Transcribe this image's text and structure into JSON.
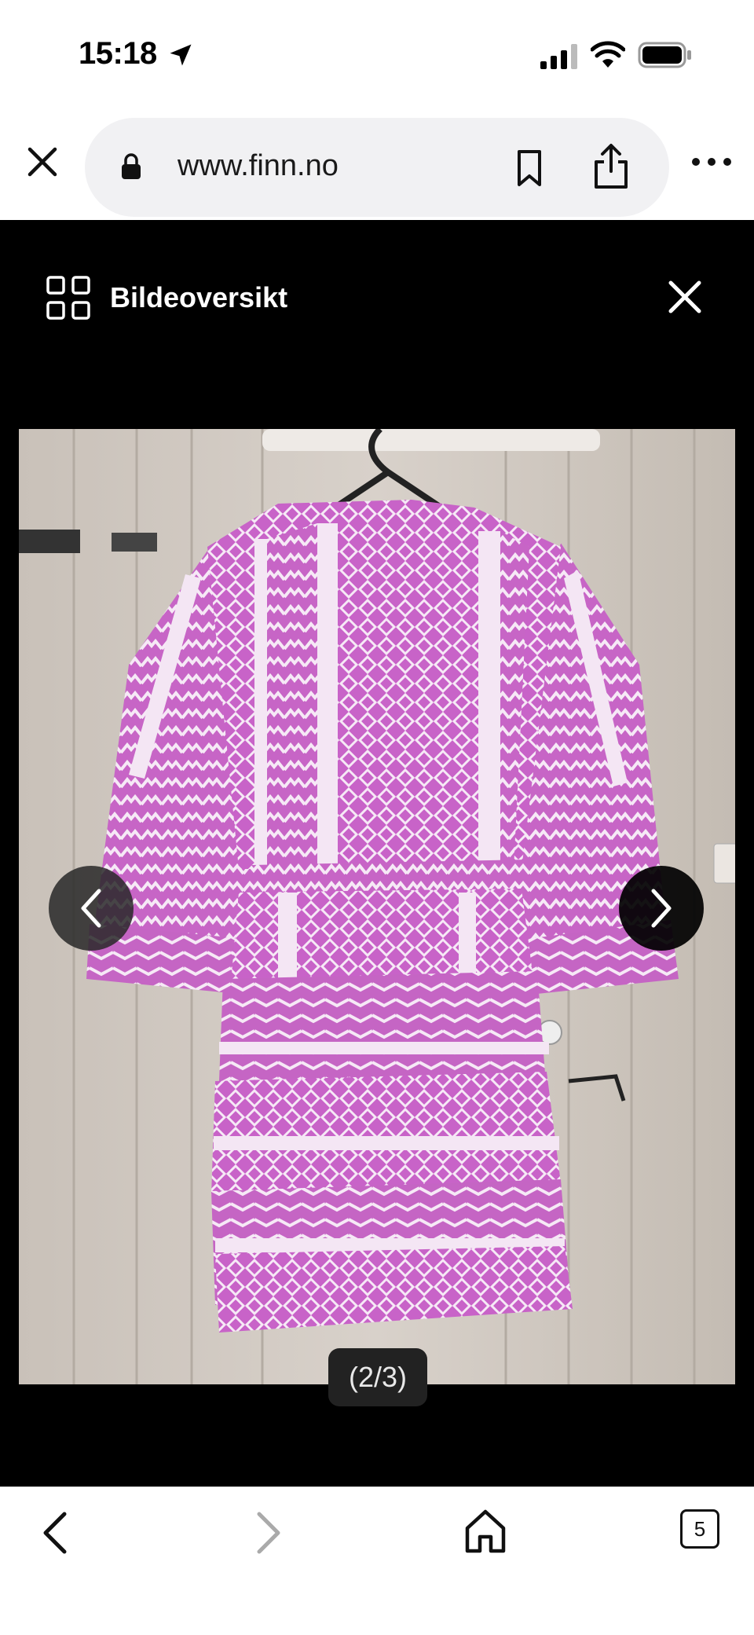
{
  "status_bar": {
    "time": "15:18",
    "icons": [
      "location-arrow-icon",
      "cellular-signal-icon",
      "wifi-icon",
      "battery-icon"
    ]
  },
  "browser": {
    "url": "www.finn.no",
    "icons": [
      "close-icon",
      "lock-icon",
      "bookmark-icon",
      "share-icon",
      "more-icon"
    ]
  },
  "viewer": {
    "overview_label": "Bildeoversikt",
    "counter": "(2/3)",
    "colors": {
      "background": "#000000",
      "dress_pink": "#c86ac8",
      "dress_white": "#f4e8f4"
    }
  },
  "toolbar": {
    "tab_count": "5",
    "icons": [
      "back-icon",
      "forward-icon",
      "home-icon",
      "tabs-icon"
    ]
  }
}
